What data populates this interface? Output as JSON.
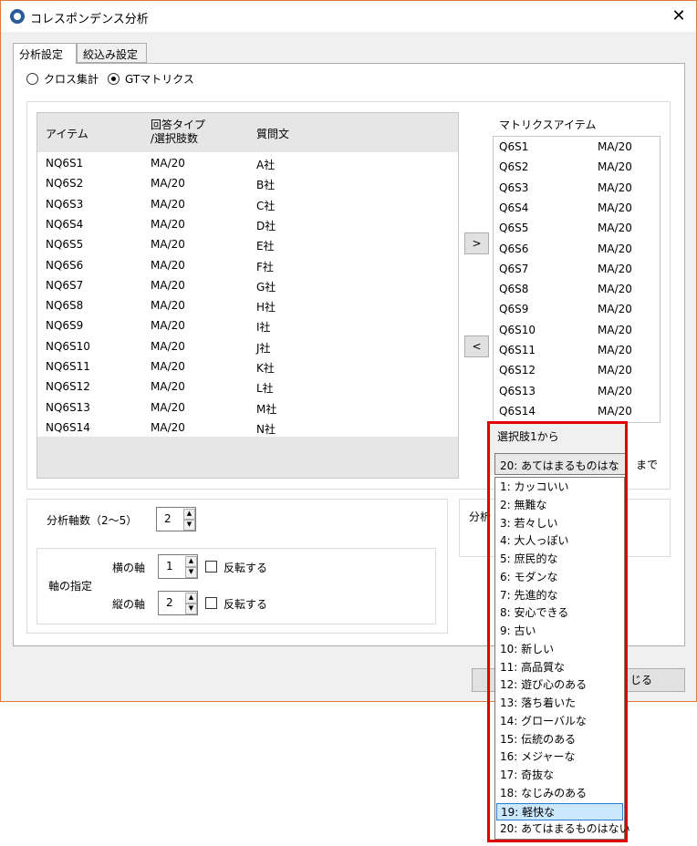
{
  "window": {
    "title": "コレスポンデンス分析"
  },
  "tabs": [
    {
      "label": "分析設定"
    },
    {
      "label": "絞込み設定"
    }
  ],
  "mode": {
    "options": [
      "クロス集計",
      "GTマトリクス"
    ],
    "selected": "GTマトリクス"
  },
  "items_table": {
    "headers": {
      "item": "アイテム",
      "type": "回答タイプ\n/選択肢数",
      "question": "質問文"
    },
    "rows": [
      {
        "item": "NQ6S1",
        "type": "MA/20",
        "question": "A社"
      },
      {
        "item": "NQ6S2",
        "type": "MA/20",
        "question": "B社"
      },
      {
        "item": "NQ6S3",
        "type": "MA/20",
        "question": "C社"
      },
      {
        "item": "NQ6S4",
        "type": "MA/20",
        "question": "D社"
      },
      {
        "item": "NQ6S5",
        "type": "MA/20",
        "question": "E社"
      },
      {
        "item": "NQ6S6",
        "type": "MA/20",
        "question": "F社"
      },
      {
        "item": "NQ6S7",
        "type": "MA/20",
        "question": "G社"
      },
      {
        "item": "NQ6S8",
        "type": "MA/20",
        "question": "H社"
      },
      {
        "item": "NQ6S9",
        "type": "MA/20",
        "question": "I社"
      },
      {
        "item": "NQ6S10",
        "type": "MA/20",
        "question": "J社"
      },
      {
        "item": "NQ6S11",
        "type": "MA/20",
        "question": "K社"
      },
      {
        "item": "NQ6S12",
        "type": "MA/20",
        "question": "L社"
      },
      {
        "item": "NQ6S13",
        "type": "MA/20",
        "question": "M社"
      },
      {
        "item": "NQ6S14",
        "type": "MA/20",
        "question": "N社"
      }
    ]
  },
  "move_buttons": {
    "add": ">",
    "remove": "<"
  },
  "matrix": {
    "title": "マトリクスアイテム",
    "rows": [
      {
        "item": "Q6S1",
        "type": "MA/20"
      },
      {
        "item": "Q6S2",
        "type": "MA/20"
      },
      {
        "item": "Q6S3",
        "type": "MA/20"
      },
      {
        "item": "Q6S4",
        "type": "MA/20"
      },
      {
        "item": "Q6S5",
        "type": "MA/20"
      },
      {
        "item": "Q6S6",
        "type": "MA/20"
      },
      {
        "item": "Q6S7",
        "type": "MA/20"
      },
      {
        "item": "Q6S8",
        "type": "MA/20"
      },
      {
        "item": "Q6S9",
        "type": "MA/20"
      },
      {
        "item": "Q6S10",
        "type": "MA/20"
      },
      {
        "item": "Q6S11",
        "type": "MA/20"
      },
      {
        "item": "Q6S12",
        "type": "MA/20"
      },
      {
        "item": "Q6S13",
        "type": "MA/20"
      },
      {
        "item": "Q6S14",
        "type": "MA/20"
      }
    ]
  },
  "range": {
    "from_label": "選択肢1から",
    "combo_value": "20: あてはまるものはな",
    "to_label": "まで",
    "options": [
      "1: カッコいい",
      "2: 無難な",
      "3: 若々しい",
      "4: 大人っぽい",
      "5: 庶民的な",
      "6: モダンな",
      "7: 先進的な",
      "8: 安心できる",
      "9: 古い",
      "10: 新しい",
      "11: 高品質な",
      "12: 遊び心のある",
      "13: 落ち着いた",
      "14: グローバルな",
      "15: 伝統のある",
      "16: メジャーな",
      "17: 奇抜な",
      "18: なじみのある",
      "19: 軽快な",
      "20: あてはまるものはない"
    ],
    "highlighted": "19: 軽快な"
  },
  "axes": {
    "count_label": "分析軸数（2〜5）",
    "count_value": "2",
    "group_label": "軸の指定",
    "horizontal_label": "横の軸",
    "horizontal_value": "1",
    "vertical_label": "縦の軸",
    "vertical_value": "2",
    "reverse_label": "反転する"
  },
  "partial": {
    "right_group_label": "分析",
    "close_button_partial": "じる"
  },
  "colors": {
    "highlight_border": "#e00000",
    "selection": "#cce8ff",
    "window_border": "#e07a3a"
  }
}
